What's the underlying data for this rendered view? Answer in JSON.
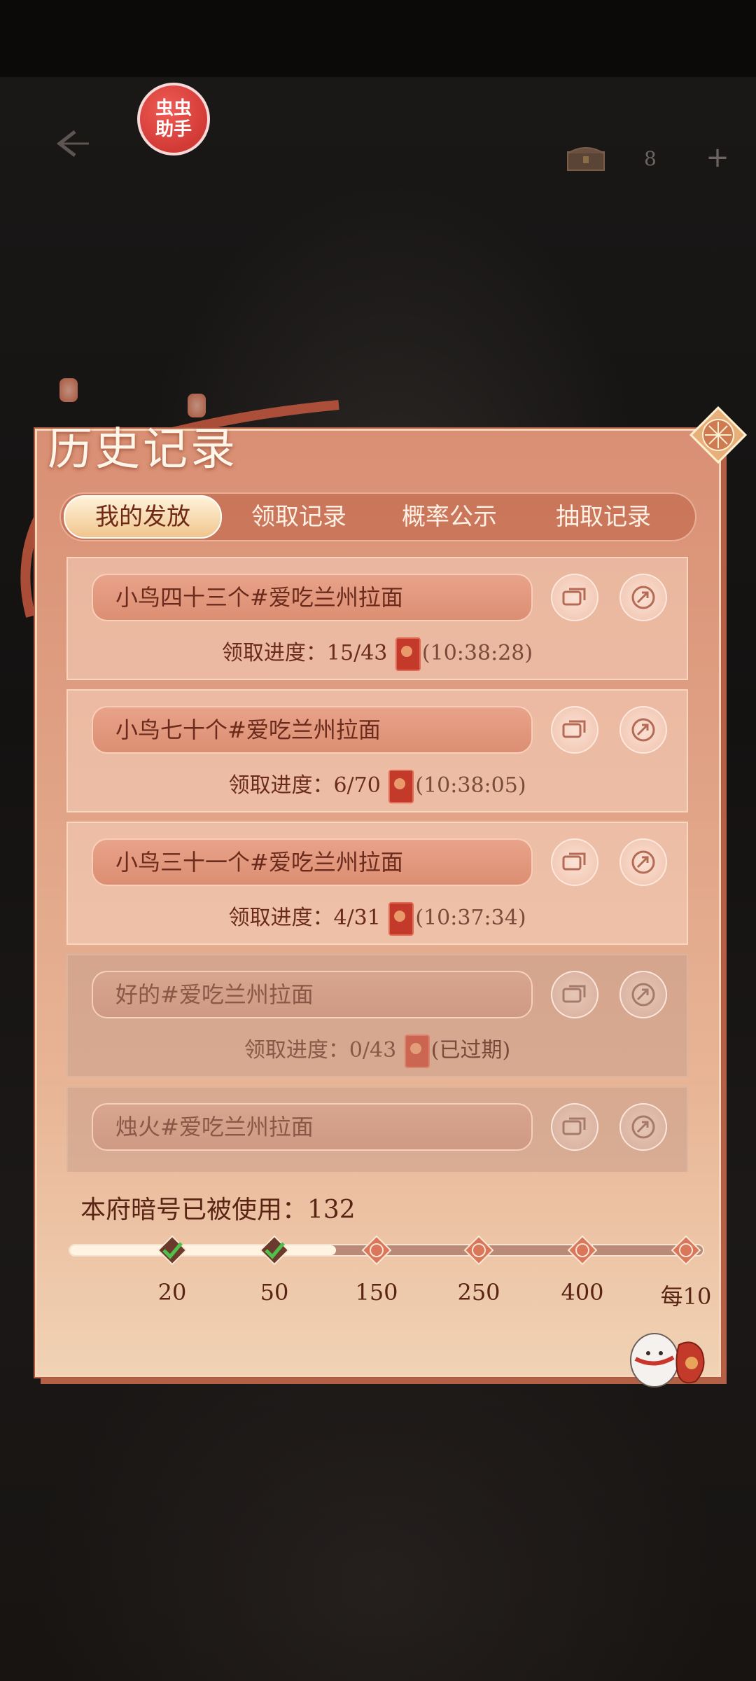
{
  "header": {
    "assistant_badge": "虫虫\n助手",
    "resource_count": "8",
    "plus": "+"
  },
  "panel": {
    "title": "历史记录",
    "tabs": [
      {
        "label": "我的发放",
        "active": true
      },
      {
        "label": "领取记录",
        "active": false
      },
      {
        "label": "概率公示",
        "active": false
      },
      {
        "label": "抽取记录",
        "active": false
      }
    ],
    "records": [
      {
        "name": "小鸟四十三个#爱吃兰州拉面",
        "progress_label": "领取进度：",
        "progress": "15/43",
        "time": "(10:38:28)",
        "expired": false
      },
      {
        "name": "小鸟七十个#爱吃兰州拉面",
        "progress_label": "领取进度：",
        "progress": "6/70",
        "time": "(10:38:05)",
        "expired": false
      },
      {
        "name": "小鸟三十一个#爱吃兰州拉面",
        "progress_label": "领取进度：",
        "progress": "4/31",
        "time": "(10:37:34)",
        "expired": false
      },
      {
        "name": "好的#爱吃兰州拉面",
        "progress_label": "领取进度：",
        "progress": "0/43",
        "time": "(已过期)",
        "expired": true
      },
      {
        "name": "烛火#爱吃兰州拉面",
        "progress_label": "",
        "progress": "",
        "time": "",
        "expired": true
      }
    ],
    "usage": {
      "label": "本府暗号已被使用：132",
      "used": 132,
      "milestones": [
        {
          "label": "20",
          "claimed": true
        },
        {
          "label": "50",
          "claimed": true
        },
        {
          "label": "150",
          "claimed": false
        },
        {
          "label": "250",
          "claimed": false
        },
        {
          "label": "400",
          "claimed": false
        },
        {
          "label": "每10",
          "claimed": false
        }
      ]
    }
  },
  "icons": {
    "back": "back-arrow-icon",
    "copy": "copy-icon",
    "share": "share-icon",
    "envelope": "red-envelope-icon",
    "milestone": "gift-node-icon",
    "check": "check-icon"
  },
  "colors": {
    "panel_top": "#d98f73",
    "panel_bottom": "#f1d2b4",
    "text_dark": "#6b2b1c",
    "tab_active": "#f0c58e",
    "check_green": "#4fc04a"
  }
}
